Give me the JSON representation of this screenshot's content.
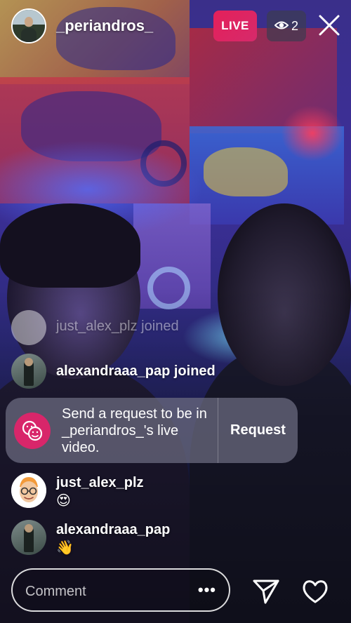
{
  "header": {
    "username": "_periandros_",
    "live_label": "LIVE",
    "viewer_count": "2"
  },
  "comments": {
    "faded_join": "just_alex_plz joined",
    "alexandra_join": "alexandraaa_pap joined",
    "alex": {
      "user": "just_alex_plz",
      "message": "😍"
    },
    "alexandra": {
      "user": "alexandraaa_pap",
      "message": "👋"
    }
  },
  "request_card": {
    "text": "Send a request to be in _periandros_'s live video.",
    "button_label": "Request"
  },
  "bottom_bar": {
    "comment_placeholder": "Comment",
    "more_label": "•••"
  },
  "icons": {
    "close": "close-icon",
    "eye": "eye-icon",
    "request": "faces-icon",
    "send": "send-icon",
    "like": "heart-icon"
  },
  "colors": {
    "live": "#e4205a",
    "request_icon": "#d8266a"
  }
}
